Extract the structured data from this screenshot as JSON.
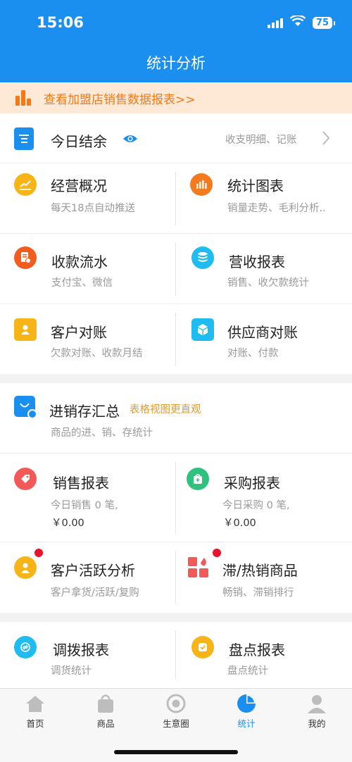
{
  "status": {
    "time": "15:06",
    "battery": "75"
  },
  "nav": {
    "title": "统计分析"
  },
  "banner": {
    "text": "查看加盟店销售数据报表>>"
  },
  "today": {
    "title": "今日结余",
    "right_text": "收支明细、记账"
  },
  "grid1": [
    {
      "title": "经营概况",
      "sub": "每天18点自动推送"
    },
    {
      "title": "统计图表",
      "sub": "销量走势、毛利分析.."
    },
    {
      "title": "收款流水",
      "sub": "支付宝、微信"
    },
    {
      "title": "营收报表",
      "sub": "销售、收欠款统计"
    },
    {
      "title": "客户对账",
      "sub": "欠款对账、收款月结"
    },
    {
      "title": "供应商对账",
      "sub": "对账、付款"
    }
  ],
  "inventory": {
    "title": "进销存汇总",
    "tag": "表格视图更直观",
    "sub": "商品的进、销、存统计"
  },
  "sales": {
    "title": "销售报表",
    "line1": "今日销售 0 笔,",
    "line2": "￥0.00"
  },
  "purchase": {
    "title": "采购报表",
    "line1": "今日采购 0 笔,",
    "line2": "￥0.00"
  },
  "grid2": [
    {
      "title": "客户活跃分析",
      "sub": "客户拿货/活跃/复购"
    },
    {
      "title": "滞/热销商品",
      "sub": "畅销、滞销排行"
    },
    {
      "title": "调拨报表",
      "sub": "调货统计"
    },
    {
      "title": "盘点报表",
      "sub": "盘点统计"
    }
  ],
  "tabs": [
    {
      "label": "首页",
      "icon": "home-icon"
    },
    {
      "label": "商品",
      "icon": "bag-icon"
    },
    {
      "label": "生意圈",
      "icon": "circle-icon"
    },
    {
      "label": "统计",
      "icon": "pie-chart-icon"
    },
    {
      "label": "我的",
      "icon": "person-icon"
    }
  ],
  "colors": {
    "primary": "#1b8ff0",
    "banner_text": "#f27a18",
    "yellow": "#f7b417",
    "orange": "#f47a20",
    "orange_red": "#f25c1f",
    "cyan": "#1ebcf0",
    "red": "#f25a5a",
    "green": "#2ec27e",
    "badge": "#e8132c"
  }
}
